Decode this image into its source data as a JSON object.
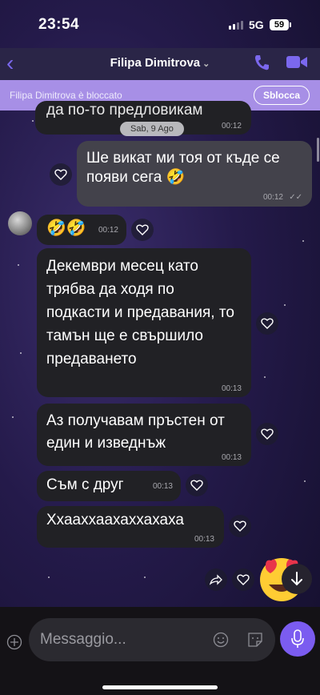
{
  "status_bar": {
    "time": "23:54",
    "network": "5G",
    "battery": "59"
  },
  "header": {
    "contact_name": "Filipa Dimitrova"
  },
  "banner": {
    "text": "Filipa Dimitrova è bloccato",
    "unblock_label": "Sblocca"
  },
  "date_separator": "Sab, 9 Ago",
  "messages": [
    {
      "direction": "incoming",
      "text": "да по-то предловикам",
      "time": "00:12"
    },
    {
      "direction": "outgoing",
      "text": "Ше викат ми тоя от къде се появи сега 🤣",
      "time": "00:12"
    },
    {
      "direction": "incoming",
      "text": "🤣🤣",
      "time": "00:12"
    },
    {
      "direction": "incoming",
      "text": "Декември месец като трябва да ходя по подкасти и предавания, то тамън ще е свършило предаването",
      "time": "00:13"
    },
    {
      "direction": "incoming",
      "text": "Аз получавам пръстен от един и изведнъж",
      "time": "00:13"
    },
    {
      "direction": "incoming",
      "text": "Съм с друг",
      "time": "00:13"
    },
    {
      "direction": "incoming",
      "text": "Ххааххаахаххахаха",
      "time": "00:13"
    }
  ],
  "composer": {
    "placeholder": "Messaggio..."
  },
  "icons": {
    "back": "chevron-left-icon",
    "call": "phone-icon",
    "video": "video-camera-icon",
    "like": "heart-icon",
    "forward": "forward-arrow-icon",
    "scroll_down": "arrow-down-icon",
    "add": "plus-circle-icon",
    "sticker": "smiley-icon",
    "gif": "gif-sticker-icon",
    "mic": "microphone-icon"
  },
  "colors": {
    "accent": "#7b5cf0",
    "banner": "#a78fe6",
    "incoming_bubble": "#212125",
    "outgoing_bubble": "#43424b"
  }
}
